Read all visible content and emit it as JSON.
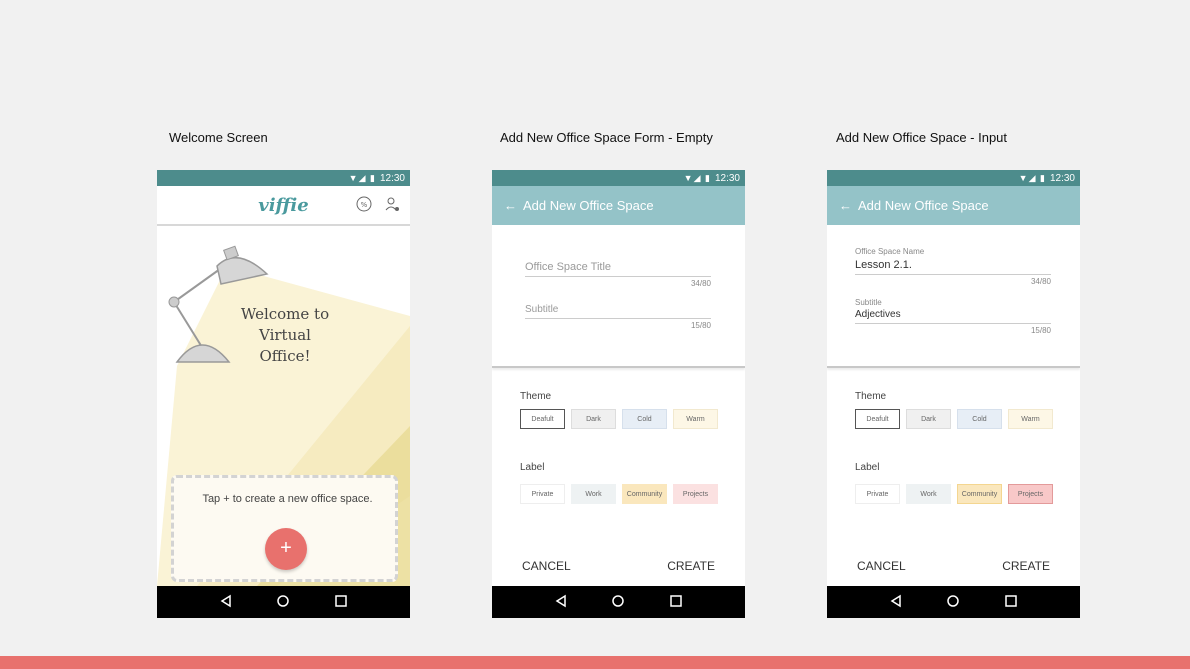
{
  "captions": {
    "welcome": "Welcome Screen",
    "empty": "Add New Office Space Form - Empty",
    "input": "Add New Office Space - Input"
  },
  "statusbar": {
    "time": "12:30"
  },
  "welcome": {
    "logo": "viffie",
    "title_line1": "Welcome to",
    "title_line2": "Virtual",
    "title_line3": "Office!",
    "tap_text": "Tap + to create a new office space.",
    "fab_label": "+"
  },
  "form": {
    "appbar_title": "Add New Office Space",
    "title_placeholder": "Office Space Title",
    "title_small_label": "Office Space Name",
    "title_value": "Lesson 2.1.",
    "title_counter": "34/80",
    "subtitle_placeholder": "Subtitle",
    "subtitle_small_label": "Subtitle",
    "subtitle_value": "Adjectives",
    "subtitle_counter": "15/80",
    "theme_label": "Theme",
    "themes": [
      "Deafult",
      "Dark",
      "Cold",
      "Warm"
    ],
    "label_label": "Label",
    "labels": [
      "Private",
      "Work",
      "Community",
      "Projects"
    ],
    "cancel": "CANCEL",
    "create": "CREATE"
  },
  "colors": {
    "statusbar": "#4d8c8c",
    "appbar": "#94c3c8",
    "accent": "#e8716d",
    "logo": "#4a9a9e",
    "chip_dark": "#f0f0f0",
    "chip_cold": "#e7eef6",
    "chip_warm": "#fdf7e6",
    "chip_work": "#eef2f3",
    "chip_community": "#fae7bd",
    "chip_projects": "#fbe1e1"
  }
}
